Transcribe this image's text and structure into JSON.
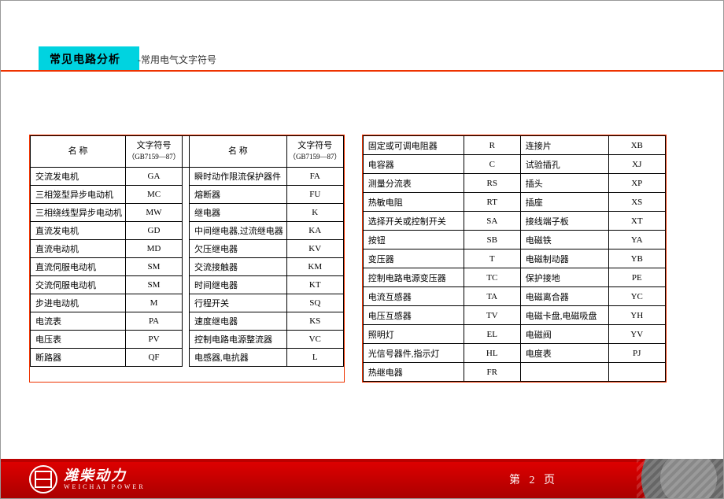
{
  "header": {
    "title_main": "常见电路分析",
    "title_suffix": "-常用电气文字符号"
  },
  "table1": {
    "col_name": "名   称",
    "col_symbol": "文字符号",
    "col_symbol_sub": "（GB7159—87）",
    "left": [
      {
        "n": "交流发电机",
        "s": "GA"
      },
      {
        "n": "三相笼型异步电动机",
        "s": "MC"
      },
      {
        "n": "三相绕线型异步电动机",
        "s": "MW"
      },
      {
        "n": "直流发电机",
        "s": "GD"
      },
      {
        "n": "直流电动机",
        "s": "MD"
      },
      {
        "n": "直流伺服电动机",
        "s": "SM"
      },
      {
        "n": "交流伺服电动机",
        "s": "SM"
      },
      {
        "n": "步进电动机",
        "s": "M"
      },
      {
        "n": "电流表",
        "s": "PA"
      },
      {
        "n": "电压表",
        "s": "PV"
      },
      {
        "n": "断路器",
        "s": "QF"
      }
    ],
    "right": [
      {
        "n": "瞬时动作限流保护器件",
        "s": "FA"
      },
      {
        "n": "熔断器",
        "s": "FU"
      },
      {
        "n": "继电器",
        "s": "K"
      },
      {
        "n": "中间继电器,过流继电器",
        "s": "KA"
      },
      {
        "n": "欠压继电器",
        "s": "KV"
      },
      {
        "n": "交流接触器",
        "s": "KM"
      },
      {
        "n": "时间继电器",
        "s": "KT"
      },
      {
        "n": "行程开关",
        "s": "SQ"
      },
      {
        "n": "速度继电器",
        "s": "KS"
      },
      {
        "n": "控制电路电源整流器",
        "s": "VC"
      },
      {
        "n": "电感器,电抗器",
        "s": "L"
      }
    ]
  },
  "table2": {
    "left": [
      {
        "n": "固定或可调电阻器",
        "s": "R"
      },
      {
        "n": "电容器",
        "s": "C"
      },
      {
        "n": "测量分流表",
        "s": "RS"
      },
      {
        "n": "热敏电阻",
        "s": "RT"
      },
      {
        "n": "选择开关或控制开关",
        "s": "SA"
      },
      {
        "n": "按钮",
        "s": "SB"
      },
      {
        "n": "变压器",
        "s": "T"
      },
      {
        "n": "控制电路电源变压器",
        "s": "TC"
      },
      {
        "n": "电流互感器",
        "s": "TA"
      },
      {
        "n": "电压互感器",
        "s": "TV"
      },
      {
        "n": "照明灯",
        "s": "EL"
      },
      {
        "n": "光信号器件,指示灯",
        "s": "HL"
      },
      {
        "n": "热继电器",
        "s": "FR"
      }
    ],
    "right": [
      {
        "n": "连接片",
        "s": "XB"
      },
      {
        "n": "试验插孔",
        "s": "XJ"
      },
      {
        "n": "插头",
        "s": "XP"
      },
      {
        "n": "插座",
        "s": "XS"
      },
      {
        "n": "接线端子板",
        "s": "XT"
      },
      {
        "n": "电磁铁",
        "s": "YA"
      },
      {
        "n": "电磁制动器",
        "s": "YB"
      },
      {
        "n": "保护接地",
        "s": "PE"
      },
      {
        "n": "电磁离合器",
        "s": "YC"
      },
      {
        "n": "电磁卡盘,电磁吸盘",
        "s": "YH"
      },
      {
        "n": "电磁阀",
        "s": "YV"
      },
      {
        "n": "电度表",
        "s": "PJ"
      }
    ]
  },
  "footer": {
    "brand_cn": "潍柴动力",
    "brand_en": "WEICHAI POWER",
    "page_prefix": "第",
    "page_num": "2",
    "page_suffix": "页"
  }
}
